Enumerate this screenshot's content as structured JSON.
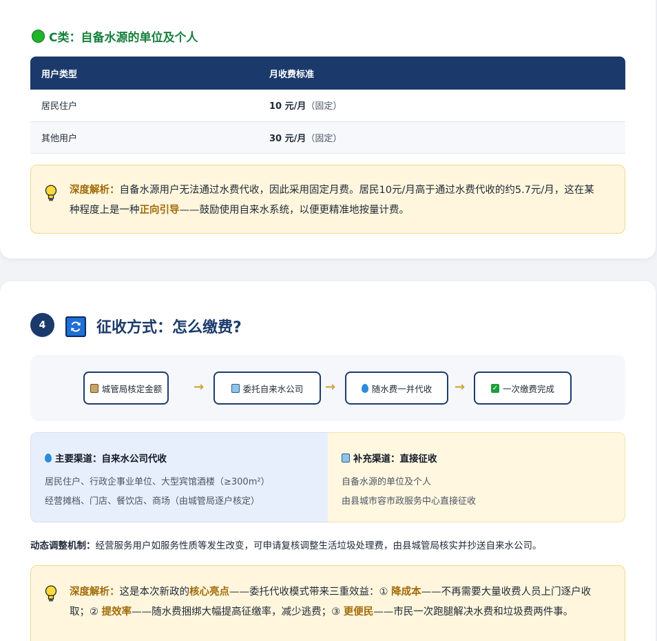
{
  "section_c": {
    "title": "C类：自备水源的单位及个人",
    "table": {
      "headers": [
        "用户类型",
        "月收费标准"
      ],
      "rows": [
        {
          "type": "居民住户",
          "amount": "10 元/月",
          "note": "（固定）"
        },
        {
          "type": "其他用户",
          "amount": "30 元/月",
          "note": "（固定）"
        }
      ]
    },
    "insight": {
      "lead": "深度解析：",
      "text_before": "自备水源用户无法通过水费代收，因此采用固定月费。居民10元/月高于通过水费代收的约5.7元/月，这在某种程度上是一种",
      "highlight": "正向引导",
      "text_after": "——鼓励使用自来水系统，以便更精准地按量计费。"
    }
  },
  "section_4": {
    "number": "4",
    "icon": "refresh-icon",
    "title": "征收方式：怎么缴费?",
    "flow": [
      {
        "label": "城管局核定金额",
        "icon": "clipboard-icon"
      },
      {
        "label": "委托自来水公司",
        "icon": "office-building-icon"
      },
      {
        "label": "随水费一并代收",
        "icon": "droplet-icon"
      },
      {
        "label": "一次缴费完成",
        "icon": "check-box-icon"
      }
    ],
    "arrow": "→",
    "channels": {
      "main": {
        "title": "主要渠道：自来水公司代收",
        "icon": "droplet-icon",
        "lines": [
          "居民住户、行政企事业单位、大型宾馆酒楼（≥300m²）",
          "经营摊档、门店、餐饮店、商场（由城管局逐户核定）"
        ]
      },
      "supplement": {
        "title": "补充渠道：直接征收",
        "icon": "office-building-icon",
        "lines": [
          "自备水源的单位及个人",
          "由县城市容市政服务中心直接征收"
        ]
      }
    },
    "dynamic": {
      "label": "动态调整机制：",
      "text": "经营服务用户如服务性质等发生改变，可申请复核调整生活垃圾处理费，由县城管局核实并抄送自来水公司。"
    },
    "insight": {
      "lead": "深度解析：",
      "t1": "这是本次新政的",
      "h1": "核心亮点",
      "t2": "——委托代收模式带来三重效益：① ",
      "h2": "降成本",
      "t3": "——不再需要大量收费人员上门逐户收取；② ",
      "h3": "提效率",
      "t4": "——随水费捆绑大幅提高征缴率，减少逃费；③ ",
      "h4": "更便民",
      "t5": "——市民一次跑腿解决水费和垃圾费两件事。"
    }
  },
  "colors": {
    "navy": "#1b3a6b",
    "green_title": "#16803c",
    "gold_highlight": "#a26b08",
    "tip_bg": "#fff6dd"
  }
}
